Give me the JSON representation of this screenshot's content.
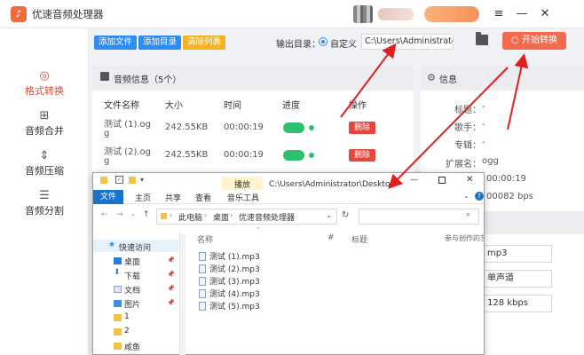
{
  "app": {
    "title": "优速音频处理器",
    "logo_text": "♪"
  },
  "window_controls": {
    "menu": "≡",
    "minimize": "—",
    "close": "✕"
  },
  "sidebar": {
    "items": [
      {
        "label": "格式转换",
        "icon": "format-convert-icon",
        "active": true
      },
      {
        "label": "音频合并",
        "icon": "merge-icon",
        "active": false
      },
      {
        "label": "音频压缩",
        "icon": "compress-icon",
        "active": false
      },
      {
        "label": "音频分割",
        "icon": "split-icon",
        "active": false
      }
    ]
  },
  "toolbar": {
    "add_file": "添加文件",
    "add_folder": "添加目录",
    "clear_list": "清除列表",
    "output_label": "输出目录：",
    "custom_label": "自定义",
    "output_path": "C:\\Users\\Administrator\\",
    "start_label": "开始转换"
  },
  "audio_panel": {
    "title": "音频信息（5个）",
    "columns": [
      "文件名称",
      "大小",
      "时间",
      "进度",
      "操作"
    ],
    "rows": [
      {
        "name_line1": "测试 (1).og",
        "name_line2": "g",
        "size": "242.55KB",
        "time": "00:00:19",
        "action": "删除"
      },
      {
        "name_line1": "测试 (2).og",
        "name_line2": "g",
        "size": "242.55KB",
        "time": "00:00:19",
        "action": "删除"
      }
    ]
  },
  "info_panel": {
    "title": "信息",
    "fields": [
      {
        "label": "标题：",
        "value": "-"
      },
      {
        "label": "歌手：",
        "value": "-"
      },
      {
        "label": "专辑：",
        "value": "-"
      },
      {
        "label": "扩展名：",
        "value": "ogg"
      }
    ],
    "duration": "00:00:19",
    "bitrate": "00082 bps",
    "selects": [
      "mp3",
      "单声道",
      "128 kbps"
    ]
  },
  "explorer": {
    "title_path": "C:\\Users\\Administrator\\Desktop\\优",
    "tabs": [
      "文件",
      "主页",
      "共享",
      "查看",
      "音乐工具"
    ],
    "play_tab": "播放",
    "breadcrumb": [
      "此电脑",
      "桌面",
      "优速音频处理器"
    ],
    "nav_items": [
      {
        "label": "快速访问",
        "pin": false
      },
      {
        "label": "桌面",
        "pin": true
      },
      {
        "label": "下载",
        "pin": true
      },
      {
        "label": "文档",
        "pin": true
      },
      {
        "label": "图片",
        "pin": true
      },
      {
        "label": "1",
        "pin": false
      },
      {
        "label": "2",
        "pin": false
      },
      {
        "label": "咸鱼",
        "pin": false
      }
    ],
    "columns": [
      "名称",
      "#",
      "标题",
      "参与创作的艺"
    ],
    "files": [
      "测试 (1).mp3",
      "测试 (2).mp3",
      "测试 (3).mp3",
      "测试 (4).mp3",
      "测试 (5).mp3"
    ]
  },
  "colors": {
    "accent_red": "#e04a3a",
    "start_button": "#f26b4f",
    "blue_button": "#2f8cf0",
    "yellow_button": "#f7b420",
    "progress_green": "#2fbf71",
    "arrow_red": "#e02020"
  }
}
